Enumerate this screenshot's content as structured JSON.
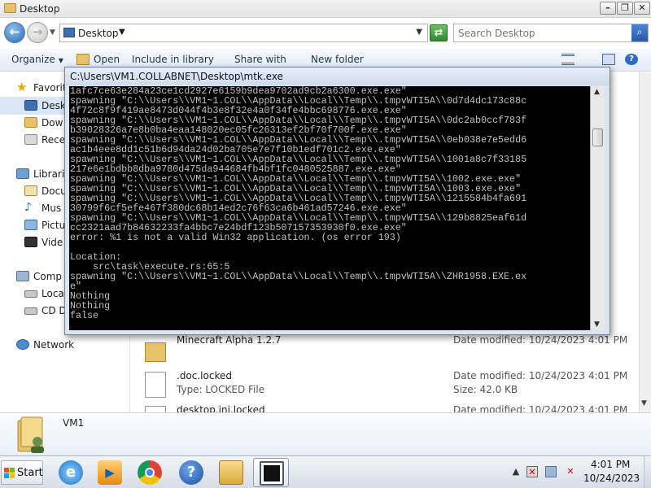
{
  "explorer": {
    "title": "Desktop",
    "address": "Desktop",
    "search_placeholder": "Search Desktop",
    "toolbar": {
      "organize": "Organize",
      "open": "Open",
      "include": "Include in library",
      "share": "Share with",
      "new_folder": "New folder"
    },
    "nav_pane": {
      "favorites": "Favorit",
      "desktop": "Desk",
      "downloads": "Dow",
      "recent": "Rece",
      "libraries": "Librari",
      "documents": "Docu",
      "music": "Mus",
      "pictures": "Pictu",
      "videos": "Vide",
      "computer": "Comp",
      "local_disk": "Loca",
      "cd_drive": "CD D",
      "network": "Network"
    },
    "files": [
      {
        "name": "Minecraft Alpha 1.2.7",
        "type": "",
        "date": "Date modified: 10/24/2023 4:01 PM",
        "size": ""
      },
      {
        "name": ".doc.locked",
        "type": "Type: LOCKED File",
        "date": "Date modified: 10/24/2023 4:01 PM",
        "size": "Size: 42.0 KB"
      },
      {
        "name": "desktop.ini.locked",
        "type": "",
        "date": "Date modified: 10/24/2023 4:01 PM",
        "size": ""
      }
    ],
    "details": {
      "name": "VM1"
    }
  },
  "console": {
    "title": "C:\\Users\\VM1.COLLABNET\\Desktop\\mtk.exe",
    "lines": [
      "1afc7ce63e284a23ce1cd2927e6159b9dea9702ad9cb2a6300.exe.exe\"",
      "spawning \"C:\\\\Users\\\\VM1~1.COL\\\\AppData\\\\Local\\\\Temp\\\\.tmpvWTI5A\\\\0d7d4dc173c88c",
      "4f72c8f9f419ae8473d044f4b3e8f32e4a0f34fe4bbc698776.exe.exe\"",
      "spawning \"C:\\\\Users\\\\VM1~1.COL\\\\AppData\\\\Local\\\\Temp\\\\.tmpvWTI5A\\\\0dc2ab0ccf783f",
      "b39028326a7e8b0ba4eaa148020ec05fc26313ef2bf70f700f.exe.exe\"",
      "spawning \"C:\\\\Users\\\\VM1~1.COL\\\\AppData\\\\Local\\\\Temp\\\\.tmpvWTI5A\\\\0eb038e7e5edd6",
      "ac1b4eee8dd1c51b6d94da24d02ba705e7e7f10b1edf701c2.exe.exe\"",
      "spawning \"C:\\\\Users\\\\VM1~1.COL\\\\AppData\\\\Local\\\\Temp\\\\.tmpvWTI5A\\\\1001a8c7f33185",
      "217e6e1bdbb8dba9780d475da944684fb4bf1fc0480525887.exe.exe\"",
      "spawning \"C:\\\\Users\\\\VM1~1.COL\\\\AppData\\\\Local\\\\Temp\\\\.tmpvWTI5A\\\\1002.exe.exe\"",
      "spawning \"C:\\\\Users\\\\VM1~1.COL\\\\AppData\\\\Local\\\\Temp\\\\.tmpvWTI5A\\\\1003.exe.exe\"",
      "spawning \"C:\\\\Users\\\\VM1~1.COL\\\\AppData\\\\Local\\\\Temp\\\\.tmpvWTI5A\\\\1215584b4fa691",
      "30799f6cf5efe467f380dc68b14ed2c76f63ca6b461ad57246.exe.exe\"",
      "spawning \"C:\\\\Users\\\\VM1~1.COL\\\\AppData\\\\Local\\\\Temp\\\\.tmpvWTI5A\\\\129b8825eaf61d",
      "cc2321aad7b84632233fa4bbc7e24bdf123b507157353930f0.exe.exe\"",
      "error: %1 is not a valid Win32 application. (os error 193)",
      "",
      "Location:",
      "    src\\task\\execute.rs:65:5",
      "spawning \"C:\\\\Users\\\\VM1~1.COL\\\\AppData\\\\Local\\\\Temp\\\\.tmpvWTI5A\\\\ZHR1958.EXE.ex",
      "e\"",
      "Nothing",
      "Nothing",
      "false"
    ]
  },
  "taskbar": {
    "start_label": "Start",
    "clock_time": "4:01 PM",
    "clock_date": "10/24/2023"
  }
}
